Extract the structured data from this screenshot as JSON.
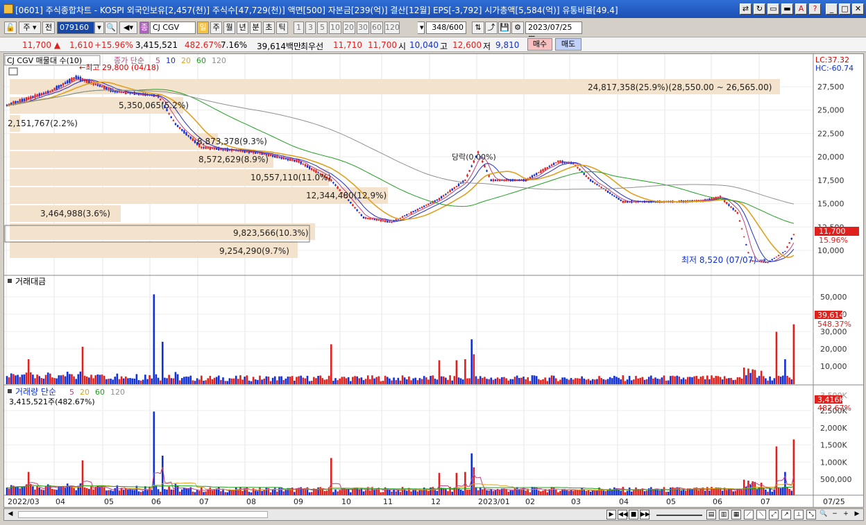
{
  "window": {
    "title": "[0601] 주식종합차트 - KOSPI 외국인보유[2,457(천)] 주식수[47,729(천)] 액면[500] 자본금[239(억)] 결산[12월] EPS[-3,792] 시가총액[5,584(억)] 유통비율[49.4]"
  },
  "toolbar": {
    "type_label": "주",
    "prev_label": "전",
    "code": "079160",
    "stock_name": "CJ CGV",
    "period_buttons": [
      "일",
      "주",
      "월",
      "년",
      "분",
      "초",
      "틱"
    ],
    "interval_buttons": [
      "1",
      "3",
      "5",
      "10",
      "20",
      "30",
      "60",
      "120"
    ],
    "count": "348",
    "count_total": "/600",
    "date": "2023/07/25"
  },
  "quote": {
    "price": "11,700",
    "change": "1,610",
    "change_pct": "+15.96%",
    "volume": "3,415,521",
    "volume_pct": "482.67%",
    "turnover": "7.16%",
    "amount": "39,614백만",
    "best_ask_label": "최우선",
    "best_ask": "11,710",
    "best_bid": "11,700",
    "open_label": "시",
    "open": "10,040",
    "high_label": "고",
    "high": "12,600",
    "low_label": "저",
    "low": "9,810",
    "buy_label": "매수",
    "sell_label": "매도"
  },
  "price_panel": {
    "legend_name": "CJ CGV 매물대 수(10)",
    "legend_ma": "종가 단순",
    "ma_periods": [
      "5",
      "10",
      "20",
      "60",
      "120"
    ],
    "lc": "LC:37.32",
    "hc": "HC:-60.74",
    "y_ticks": [
      "27,500",
      "25,000",
      "22,500",
      "20,000",
      "17,500",
      "15,000",
      "12,500",
      "10,000"
    ],
    "high_note": "최고 29,800 (04/18)",
    "low_note": "최저 8,520 (07/07)",
    "limit_note": "당락(0.00%)",
    "last_price": "11,700",
    "last_pct": "15.96%",
    "profile_labels": [
      "24,817,358(25.9%)(28,550.00 ~ 26,565.00)",
      "5,350,065(5.2%)",
      "2,151,767(2.2%)",
      "8,873,378(9.3%)",
      "8,572,629(8.9%)",
      "10,557,110(11.0%)",
      "12,344,480(12.9%)",
      "3,464,988(3.6%)",
      "9,823,566(10.3%)",
      "9,254,290(9.7%)"
    ]
  },
  "amount_panel": {
    "legend": "거래대금",
    "y_ticks": [
      "50,000",
      "40,000",
      "30,000",
      "20,000",
      "10,000"
    ],
    "last_value": "39,614",
    "last_pct": "548.37%"
  },
  "volume_panel": {
    "legend": "거래량 단순",
    "ma_periods": [
      "5",
      "20",
      "60",
      "120"
    ],
    "sub": "3,415,521주(482.67%)",
    "y_ticks": [
      "2,500K",
      "2,000K",
      "1,500K",
      "1,000K",
      "500,000"
    ],
    "last_value": "3,416K",
    "last_pct": "482.67%",
    "top_tick": "3,500K"
  },
  "x_axis": {
    "labels": [
      "2022/03",
      "04",
      "05",
      "06",
      "07",
      "08",
      "09",
      "10",
      "11",
      "12",
      "2023/01",
      "02",
      "03",
      "04",
      "05",
      "06",
      "07"
    ],
    "end_label": "07/25"
  },
  "colors": {
    "up": "#e0201c",
    "down": "#1030d8",
    "ma5": "#c04080",
    "ma10": "#2030c0",
    "ma20": "#e0a020",
    "ma60": "#20a020",
    "ma120": "#909090",
    "profile": "#f3e2cc"
  }
}
